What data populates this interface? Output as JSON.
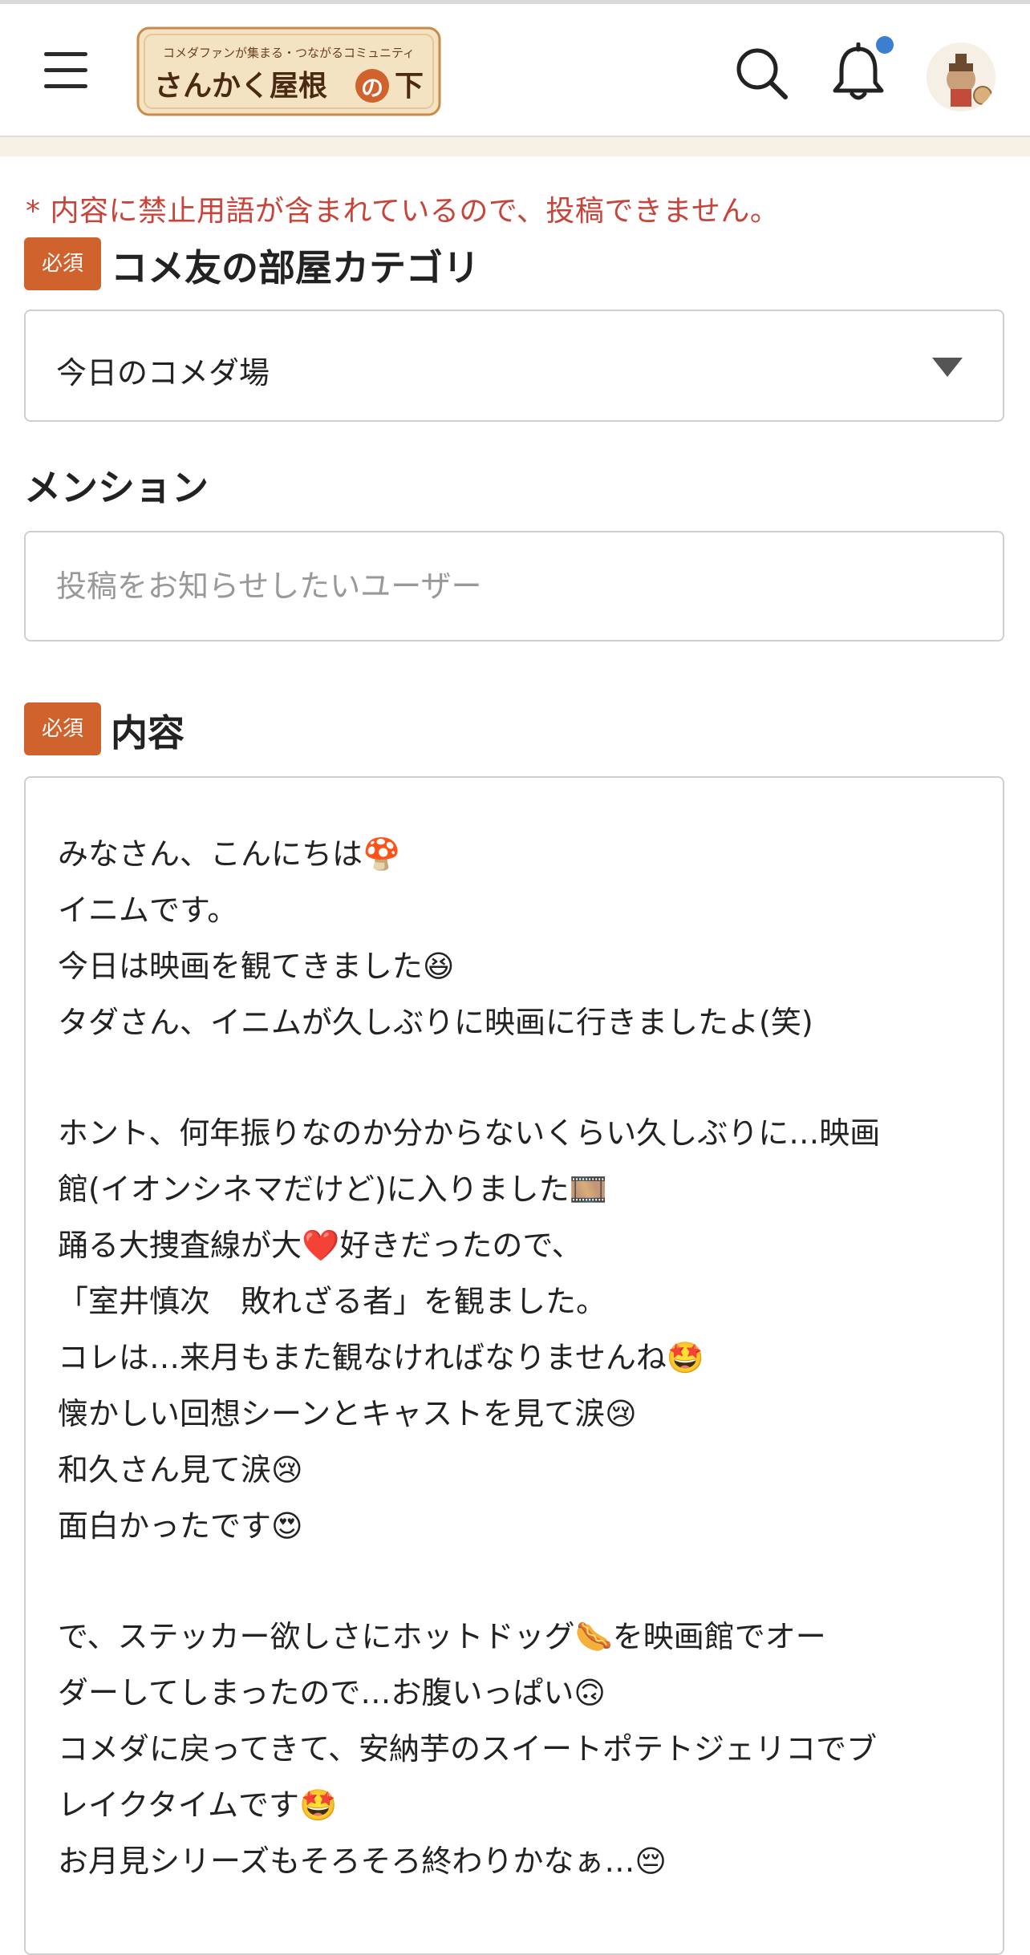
{
  "header": {
    "logo_tagline": "コメダファンが集まる・つながるコミュニティ",
    "logo_title_main": "さんかく屋根",
    "logo_title_no": "の",
    "logo_title_end": "下",
    "accent_color": "#d0622d",
    "notification_dot_color": "#3a7fd0"
  },
  "form": {
    "error_message": "* 内容に禁止用語が含まれているので、投稿できません。",
    "required_badge": "必須",
    "category": {
      "label": "コメ友の部屋カテゴリ",
      "selected_value": "今日のコメダ場"
    },
    "mention": {
      "label": "メンション",
      "placeholder": "投稿をお知らせしたいユーザー",
      "value": ""
    },
    "content": {
      "label": "内容",
      "lines": [
        "みなさん、こんにちは🍄",
        "イニムです。",
        "今日は映画を観てきました😆",
        "タダさん、イニムが久しぶりに映画に行きましたよ(笑)",
        "",
        "ホント、何年振りなのか分からないくらい久しぶりに…映画",
        "館(イオンシネマだけど)に入りました🎞️",
        "踊る大捜査線が大❤️好きだったので、",
        "「室井慎次　敗れざる者」を観ました。",
        "コレは…来月もまた観なければなりませんね🤩",
        "懐かしい回想シーンとキャストを見て涙😢",
        "和久さん見て涙😢",
        "面白かったです😍",
        "",
        "で、ステッカー欲しさにホットドッグ🌭を映画館でオー",
        "ダーしてしまったので…お腹いっぱい🙃",
        "コメダに戻ってきて、安納芋のスイートポテトジェリコでブ",
        "レイクタイムです🤩",
        "お月見シリーズもそろそろ終わりかなぁ…😔"
      ]
    }
  }
}
